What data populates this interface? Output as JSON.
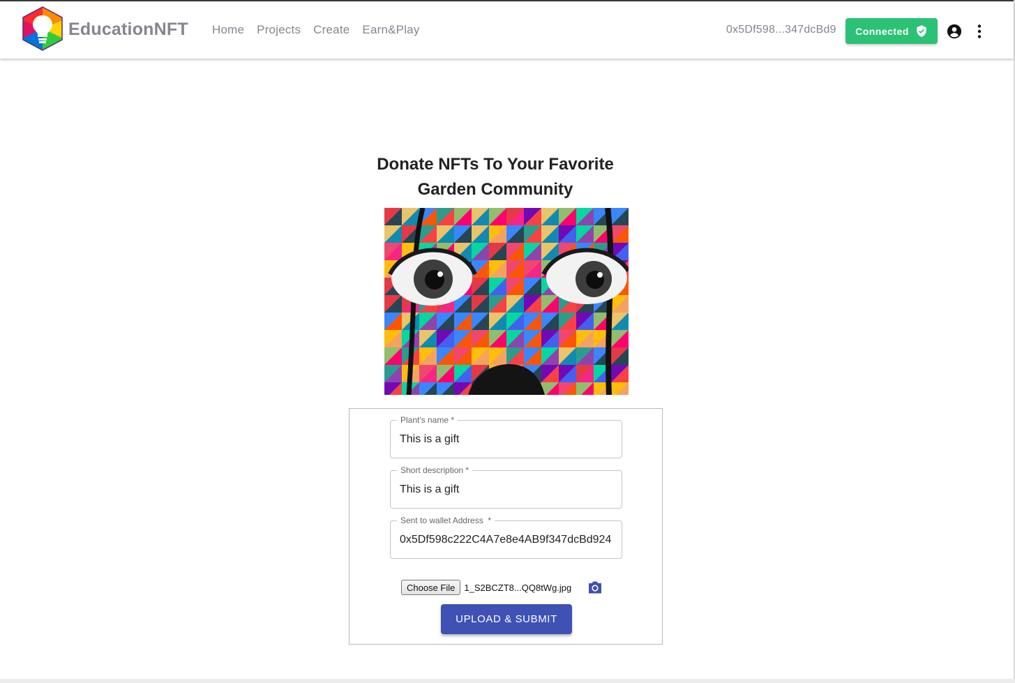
{
  "header": {
    "brand": "EducationNFT",
    "nav": [
      "Home",
      "Projects",
      "Create",
      "Earn&Play"
    ],
    "wallet_address": "0x5Df598...347dcBd9",
    "connected_label": "Connected",
    "connected_color": "#2bc276"
  },
  "main": {
    "title_line1": "Donate NFTs To Your Favorite",
    "title_line2": "Garden Community",
    "image_description": "Colorful geometric mosaic mural of a face with two large eyes",
    "form": {
      "fields": [
        {
          "label": "Plant's name",
          "required_mark": "*",
          "value": "This is a gift"
        },
        {
          "label": "Short description",
          "required_mark": "*",
          "value": "This is a gift"
        },
        {
          "label": "Sent to wallet Address",
          "required_mark": "*",
          "value": "0x5Df598c222C4A7e8e4AB9f347dcBd924"
        }
      ],
      "choose_file_label": "Choose File",
      "file_name": "1_S2BCZT8...QQ8tWg.jpg",
      "submit_label": "UPLOAD & SUBMIT",
      "accent_color": "#3f51b5"
    }
  },
  "icons": [
    "logo-lightbulb-icon",
    "shield-check-icon",
    "account-circle-icon",
    "more-vert-icon",
    "camera-icon"
  ]
}
